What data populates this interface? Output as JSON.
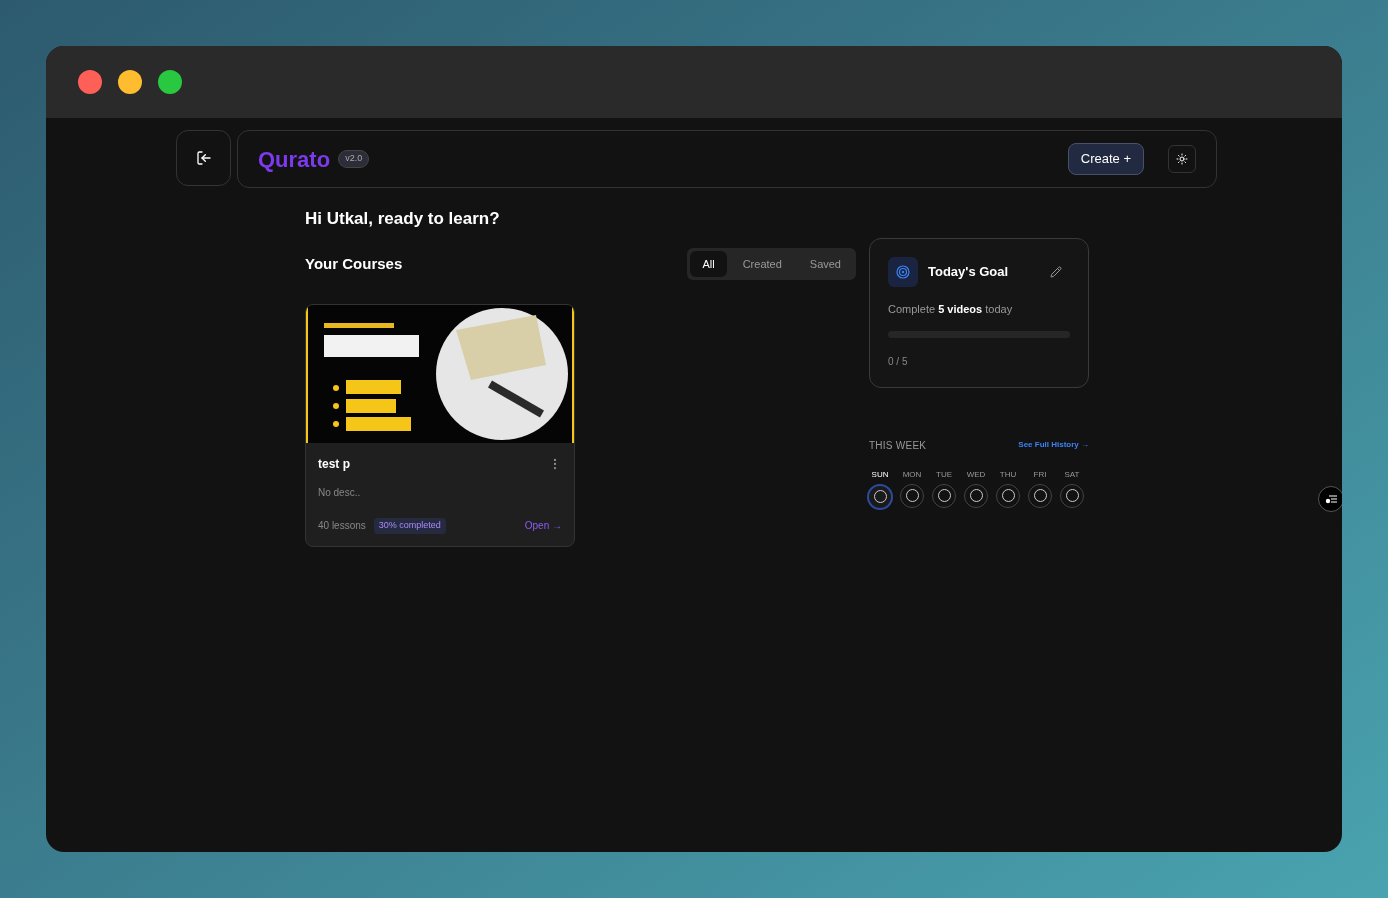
{
  "header": {
    "brand": "Qurato",
    "version": "v2.0",
    "create_button": "Create +"
  },
  "greeting": "Hi Utkal, ready to learn?",
  "courses": {
    "title": "Your Courses",
    "filters": [
      {
        "label": "All",
        "selected": true
      },
      {
        "label": "Created",
        "selected": false
      },
      {
        "label": "Saved",
        "selected": false
      }
    ],
    "items": [
      {
        "title": "test p",
        "description": "No desc..",
        "lessons": "40 lessons",
        "progress": "30% completed",
        "open": "Open →"
      }
    ]
  },
  "goal": {
    "title": "Today's Goal",
    "text": "Complete **5 videos** today",
    "level": 0,
    "count": "0 / 5"
  },
  "week": {
    "title": "THIS WEEK",
    "history_link": "See Full History →",
    "days": [
      {
        "label": "SUN",
        "selected": true
      },
      {
        "label": "MON",
        "selected": false
      },
      {
        "label": "TUE",
        "selected": false
      },
      {
        "label": "WED",
        "selected": false
      },
      {
        "label": "THU",
        "selected": false
      },
      {
        "label": "FRI",
        "selected": false
      },
      {
        "label": "SAT",
        "selected": false
      }
    ]
  }
}
